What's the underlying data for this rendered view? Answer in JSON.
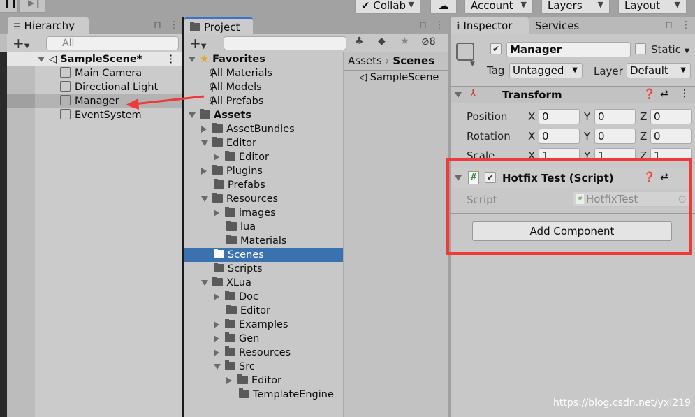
{
  "toolbar": {
    "collab": "Collab",
    "account": "Account",
    "layers": "Layers",
    "layout": "Layout"
  },
  "hierarchy": {
    "tab": "Hierarchy",
    "search_placeholder": "All",
    "scene": "SampleScene*",
    "items": [
      "Main Camera",
      "Directional Light",
      "Manager",
      "EventSystem"
    ],
    "selected": "Manager"
  },
  "project": {
    "tab": "Project",
    "hidden_count": "8",
    "breadcrumb": [
      "Assets",
      "Scenes"
    ],
    "files": [
      "SampleScene"
    ],
    "tree": [
      {
        "label": "Favorites",
        "level": 0,
        "type": "star",
        "arrow": "down"
      },
      {
        "label": "All Materials",
        "level": 1,
        "type": "search"
      },
      {
        "label": "All Models",
        "level": 1,
        "type": "search"
      },
      {
        "label": "All Prefabs",
        "level": 1,
        "type": "search"
      },
      {
        "label": "Assets",
        "level": 0,
        "type": "folder-open",
        "arrow": "down"
      },
      {
        "label": "AssetBundles",
        "level": 1,
        "type": "folder",
        "arrow": "right"
      },
      {
        "label": "Editor",
        "level": 1,
        "type": "folder-open",
        "arrow": "down"
      },
      {
        "label": "Editor",
        "level": 2,
        "type": "folder",
        "arrow": "right"
      },
      {
        "label": "Plugins",
        "level": 1,
        "type": "folder",
        "arrow": "right"
      },
      {
        "label": "Prefabs",
        "level": 1,
        "type": "folder"
      },
      {
        "label": "Resources",
        "level": 1,
        "type": "folder-open",
        "arrow": "down"
      },
      {
        "label": "images",
        "level": 2,
        "type": "folder",
        "arrow": "right"
      },
      {
        "label": "lua",
        "level": 2,
        "type": "folder"
      },
      {
        "label": "Materials",
        "level": 2,
        "type": "folder"
      },
      {
        "label": "Scenes",
        "level": 1,
        "type": "folder",
        "selected": true
      },
      {
        "label": "Scripts",
        "level": 1,
        "type": "folder"
      },
      {
        "label": "XLua",
        "level": 1,
        "type": "folder-open",
        "arrow": "down"
      },
      {
        "label": "Doc",
        "level": 2,
        "type": "folder",
        "arrow": "right"
      },
      {
        "label": "Editor",
        "level": 2,
        "type": "folder"
      },
      {
        "label": "Examples",
        "level": 2,
        "type": "folder",
        "arrow": "right"
      },
      {
        "label": "Gen",
        "level": 2,
        "type": "folder",
        "arrow": "right"
      },
      {
        "label": "Resources",
        "level": 2,
        "type": "folder",
        "arrow": "right"
      },
      {
        "label": "Src",
        "level": 2,
        "type": "folder-open",
        "arrow": "down"
      },
      {
        "label": "Editor",
        "level": 3,
        "type": "folder",
        "arrow": "right"
      },
      {
        "label": "TemplateEngine",
        "level": 3,
        "type": "folder"
      }
    ]
  },
  "inspector": {
    "tab": "Inspector",
    "tab2": "Services",
    "name": "Manager",
    "static": "Static",
    "tag_label": "Tag",
    "tag": "Untagged",
    "layer_label": "Layer",
    "layer": "Default",
    "transform": {
      "title": "Transform",
      "rows": [
        {
          "label": "Position",
          "x": "0",
          "y": "0",
          "z": "0"
        },
        {
          "label": "Rotation",
          "x": "0",
          "y": "0",
          "z": "0"
        },
        {
          "label": "Scale",
          "x": "1",
          "y": "1",
          "z": "1"
        }
      ],
      "axes": [
        "X",
        "Y",
        "Z"
      ]
    },
    "script_component": {
      "title": "Hotfix Test (Script)",
      "script_label": "Script",
      "script_value": "HotfixTest"
    },
    "add_component": "Add Component"
  },
  "watermark": "https://blog.csdn.net/yxl219",
  "colors": {
    "selection": "#3a72b0",
    "annotation": "#f03a3a"
  }
}
